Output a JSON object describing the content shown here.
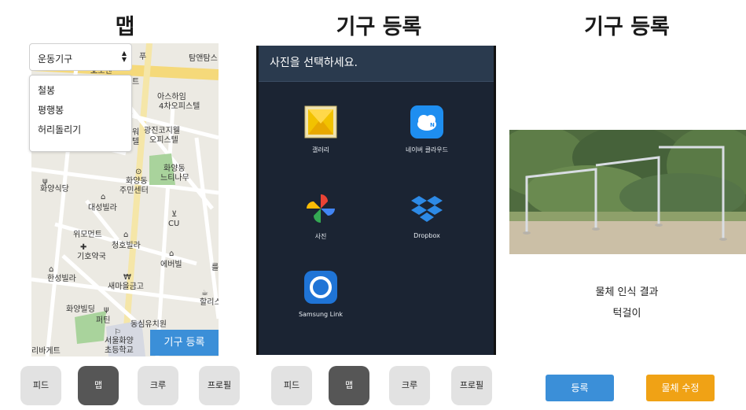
{
  "panel_map": {
    "title": "맵",
    "select_value": "운동기구",
    "options": [
      "철봉",
      "평행봉",
      "허리돌리기"
    ],
    "register_button": "기구 등록",
    "map_labels": {
      "bus": "푸",
      "tamn": "탐앤탐스",
      "top_left": "호노엔",
      "t": "트",
      "ashaim": "아스하임",
      "ashaim2": "4차오피스텔",
      "gwangjin": "광진코지웰",
      "officetel": "오피스텔",
      "wo": "워",
      "tel": "텔",
      "hwayang_neuti": "화양동",
      "neuti": "느티나무",
      "hwayang_center": "화양동",
      "center2": "주민센터",
      "hwayang_sikdang": "화양식당",
      "daesung": "대성빌라",
      "cu": "CU",
      "wimodern": "위모먼트",
      "cheongho": "청호빌라",
      "giho": "기호약국",
      "everville": "에버빌",
      "hansung": "한성빌라",
      "saemaeul": "새마을금고",
      "hwayang_bld": "화양빌딩",
      "pertin": "퍼틴",
      "halli": "할리스",
      "kinder": "동심유치원",
      "school1": "서울화양",
      "school2": "초등학교",
      "paris": "리바게트",
      "pyeong": "를"
    }
  },
  "panel_picker": {
    "title": "기구 등록",
    "header": "사진을 선택하세요.",
    "apps": [
      {
        "label": "갤러리",
        "icon": "gallery-icon"
      },
      {
        "label": "네이버 클라우드",
        "icon": "naver-cloud-icon"
      },
      {
        "label": "사진",
        "icon": "google-photos-icon"
      },
      {
        "label": "Dropbox",
        "icon": "dropbox-icon"
      },
      {
        "label": "Samsung Link",
        "icon": "samsung-link-icon"
      }
    ]
  },
  "panel_result": {
    "title": "기구 등록",
    "detect_title": "물체 인식 결과",
    "detect_value": "턱걸이",
    "register_button": "등록",
    "edit_button": "물체 수정"
  },
  "nav": [
    "피드",
    "맵",
    "크루",
    "프로필"
  ],
  "colors": {
    "accent_blue": "#3b8fd8",
    "accent_orange": "#f0a215",
    "nav_active": "#565656",
    "nav_idle": "#e2e2e2"
  }
}
